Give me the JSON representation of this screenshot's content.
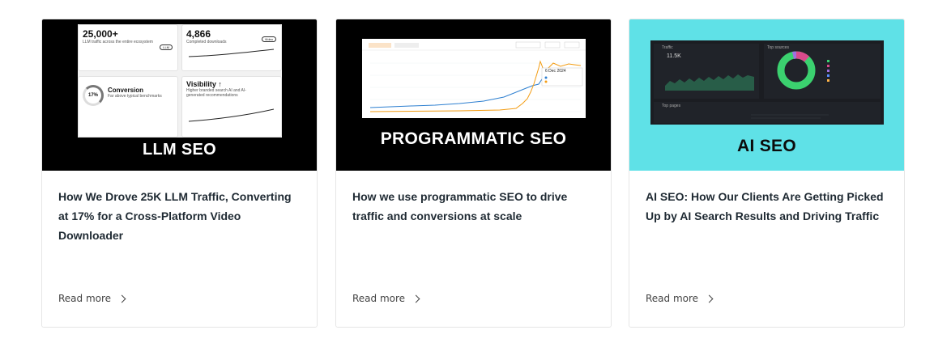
{
  "cards": [
    {
      "thumb_label": "LLM SEO",
      "title": "How We Drove 25K LLM Traffic, Converting at 17% for a Cross-Platform Video Downloader",
      "read_more": "Read more",
      "shot": {
        "stat1_value": "25,000+",
        "stat1_text": "LLM traffic across the entire ecosystem",
        "stat2_value": "4,866",
        "stat2_text": "Completed downloads",
        "conversion_label": "Conversion",
        "conversion_text": "Far above typical benchmarks",
        "conversion_rate": "17%",
        "visibility_label": "Visibility ↑",
        "visibility_text": "Higher branded search AI and AI-generated recommendations"
      }
    },
    {
      "thumb_label": "PROGRAMMATIC SEO",
      "title": "How we use programmatic SEO to drive traffic and conversions at scale",
      "read_more": "Read more",
      "shot": {
        "tooltip_date": "6 Dec 2024"
      }
    },
    {
      "thumb_label": "AI SEO",
      "title": "AI SEO: How Our Clients Are Getting Picked Up by AI Search Results and Driving Traffic",
      "read_more": "Read more",
      "shot": {
        "traffic_label": "Traffic",
        "traffic_value": "11.5K",
        "sources_label": "Top sources",
        "pages_label": "Top pages"
      }
    }
  ],
  "colors": {
    "cyan_bg": "#5fe1e7",
    "accent_orange": "#f39c12",
    "accent_blue": "#2d7fd0",
    "donut_green": "#3bd16f"
  },
  "icons": {
    "read_more_icon": "chevron-right-icon"
  }
}
